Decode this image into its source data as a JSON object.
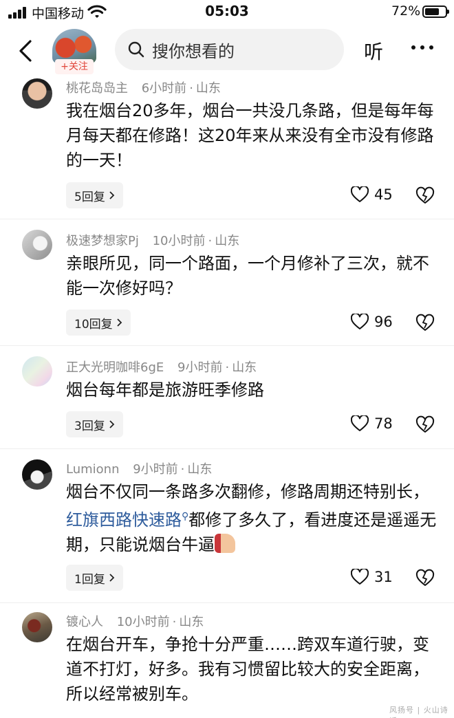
{
  "status_bar": {
    "carrier": "中国移动",
    "time": "05:03",
    "battery_percent": "72%",
    "battery_level": 0.72
  },
  "header": {
    "follow_label": "+关注",
    "search_placeholder": "搜你想看的",
    "listen_label": "听"
  },
  "comments": [
    {
      "user": "桃花岛岛主",
      "time": "6小时前",
      "location": "山东",
      "text": "我在烟台20多年，烟台一共没几条路，但是每年每月每天都在修路！这20年来从来没有全市没有修路的一天！",
      "replies": "5回复",
      "likes": "45"
    },
    {
      "user": "极速梦想家Pj",
      "time": "10小时前",
      "location": "山东",
      "text": "亲眼所见，同一个路面，一个月修补了三次，就不能一次修好吗？",
      "replies": "10回复",
      "likes": "96"
    },
    {
      "user": "正大光明咖啡6gE",
      "time": "9小时前",
      "location": "山东",
      "text": "烟台每年都是旅游旺季修路",
      "replies": "3回复",
      "likes": "78"
    },
    {
      "user": "Lumionn",
      "time": "9小时前",
      "location": "山东",
      "text_before_link": "烟台不仅同一条路多次翻修，修路周期还特别长，",
      "link": "红旗西路快速路",
      "text_after_link": "都修了多久了，看进度还是遥遥无期，只能说烟台牛逼",
      "replies": "1回复",
      "likes": "31"
    },
    {
      "user": "镀心人",
      "time": "10小时前",
      "location": "山东",
      "text": "在烟台开车，争抢十分严重……跨双车道行驶，变道不打灯，好多。我有习惯留比较大的安全距离，所以经常被别车。"
    }
  ],
  "separator": "·",
  "watermark": "风扬号 | 火山诗话",
  "icons": [
    "back-icon",
    "search-icon",
    "more-icon",
    "heart-icon",
    "dislike-heart-icon",
    "chevron-right-icon",
    "search-link-icon"
  ]
}
